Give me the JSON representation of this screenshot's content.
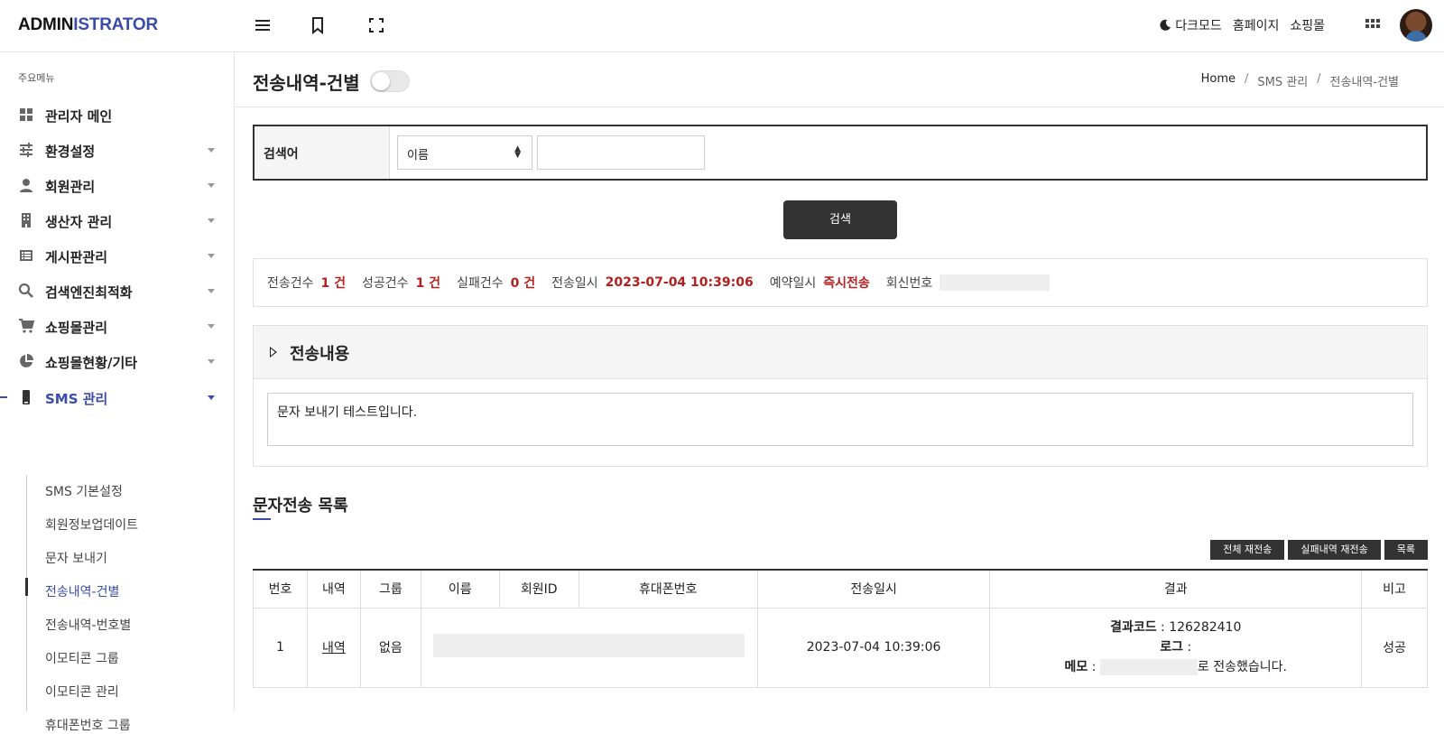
{
  "header": {
    "logo_part1": "ADMIN",
    "logo_part2": "ISTRATOR",
    "menu_icon": "menu-icon",
    "bookmark_icon": "bookmark-icon",
    "fullscreen_icon": "fullscreen-icon",
    "dark_mode": "다크모드",
    "homepage": "홈페이지",
    "shop": "쇼핑몰",
    "apps_icon": "apps-grid-icon"
  },
  "sidebar": {
    "heading": "주요메뉴",
    "items": [
      {
        "label": "관리자 메인",
        "icon": "dashboard-icon"
      },
      {
        "label": "환경설정",
        "icon": "settings-sliders-icon"
      },
      {
        "label": "회원관리",
        "icon": "person-icon"
      },
      {
        "label": "생산자 관리",
        "icon": "building-icon"
      },
      {
        "label": "게시판관리",
        "icon": "list-icon"
      },
      {
        "label": "검색엔진최적화",
        "icon": "search-icon"
      },
      {
        "label": "쇼핑몰관리",
        "icon": "cart-icon"
      },
      {
        "label": "쇼핑몰현황/기타",
        "icon": "pie-chart-icon"
      },
      {
        "label": "SMS 관리",
        "icon": "phone-icon"
      }
    ],
    "sms_sub": [
      "SMS 기본설정",
      "회원정보업데이트",
      "문자 보내기",
      "전송내역-건별",
      "전송내역-번호별",
      "이모티콘 그룹",
      "이모티콘 관리",
      "휴대폰번호 그룹"
    ]
  },
  "page": {
    "title": "전송내역-건별",
    "breadcrumb": [
      "Home",
      "SMS 관리",
      "전송내역-건별"
    ]
  },
  "search": {
    "label": "검색어",
    "select_value": "이름",
    "input_value": "",
    "button": "검색"
  },
  "stats": {
    "sent_label": "전송건수",
    "sent_value": "1 건",
    "success_label": "성공건수",
    "success_value": "1 건",
    "fail_label": "실패건수",
    "fail_value": "0 건",
    "date_label": "전송일시",
    "date_value": "2023-07-04 10:39:06",
    "reserve_label": "예약일시",
    "reserve_value": "즉시전송",
    "reply_label": "회신번호"
  },
  "panel": {
    "title": "전송내용",
    "body": "문자 보내기 테스트입니다."
  },
  "list": {
    "title": "문자전송 목록",
    "buttons": [
      "전체 재전송",
      "실패내역 재전송",
      "목록"
    ],
    "columns": [
      "번호",
      "내역",
      "그룹",
      "이름",
      "회원ID",
      "휴대폰번호",
      "전송일시",
      "결과",
      "비고"
    ],
    "rows": [
      {
        "no": "1",
        "detail": "내역",
        "group": "없음",
        "date": "2023-07-04 10:39:06",
        "result_code_label": "결과코드",
        "result_code": " : 126282410",
        "log_label": "로그",
        "log_value": " :",
        "memo_label": "메모",
        "memo_prefix": " :",
        "memo_suffix": "로 전송했습니다.",
        "note": "성공"
      }
    ]
  },
  "colors": {
    "accent": "#3b4ba8",
    "highlight": "#b3201f",
    "dark_button": "#333333"
  }
}
